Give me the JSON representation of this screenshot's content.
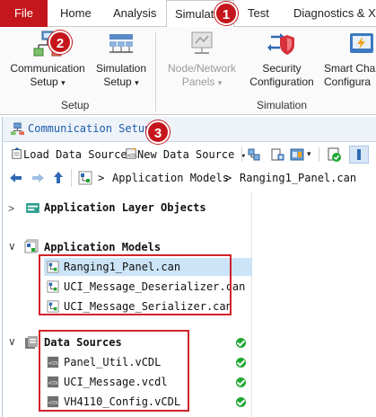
{
  "ribbon_tabs": {
    "file": "File",
    "home": "Home",
    "analysis": "Analysis",
    "simulation": "Simulatio",
    "test": "Test",
    "diagnostics": "Diagnostics & XC"
  },
  "badges": {
    "one": "1",
    "two": "2",
    "three": "3"
  },
  "ribbon": {
    "comm_setup": {
      "line1": "Communication",
      "line2": "Setup",
      "icon": "network-setup-icon"
    },
    "sim_setup": {
      "line1": "Simulation",
      "line2": "Setup",
      "icon": "simulation-setup-icon"
    },
    "node_panels": {
      "line1": "Node/Network",
      "line2": "Panels",
      "icon": "node-panels-icon"
    },
    "security": {
      "line1": "Security",
      "line2": "Configuration",
      "icon": "security-config-icon"
    },
    "smart_charging": {
      "line1": "Smart Cha",
      "line2": "Configura",
      "icon": "smart-charging-icon"
    },
    "dropdown_glyph": "▾",
    "groups": {
      "setup": "Setup",
      "simulation": "Simulation"
    }
  },
  "dock": {
    "title": "Communication Setup",
    "toolbar": {
      "load_data_source": "Load Data Source",
      "new_data_source": "New Data Source",
      "dropdown_glyph": "▾"
    },
    "breadcrumb": {
      "sep": ">",
      "part1": "Application Models",
      "part2": "Ranging1_Panel.can"
    }
  },
  "tree": {
    "app_layer": "Application Layer Objects",
    "app_models": "Application Models",
    "models": [
      "Ranging1_Panel.can",
      "UCI_Message_Deserializer.can",
      "UCI_Message_Serializer.can"
    ],
    "data_sources": "Data Sources",
    "sources": [
      "Panel_Util.vCDL",
      "UCI_Message.vcdl",
      "VH4110_Config.vCDL"
    ],
    "collapsed_chevron": ">",
    "expanded_chevron": "∨"
  },
  "colors": {
    "accent_red": "#c4161c",
    "title_blue": "#1a5ba8",
    "selection": "#cce4f7",
    "status_green": "#1ea832"
  }
}
